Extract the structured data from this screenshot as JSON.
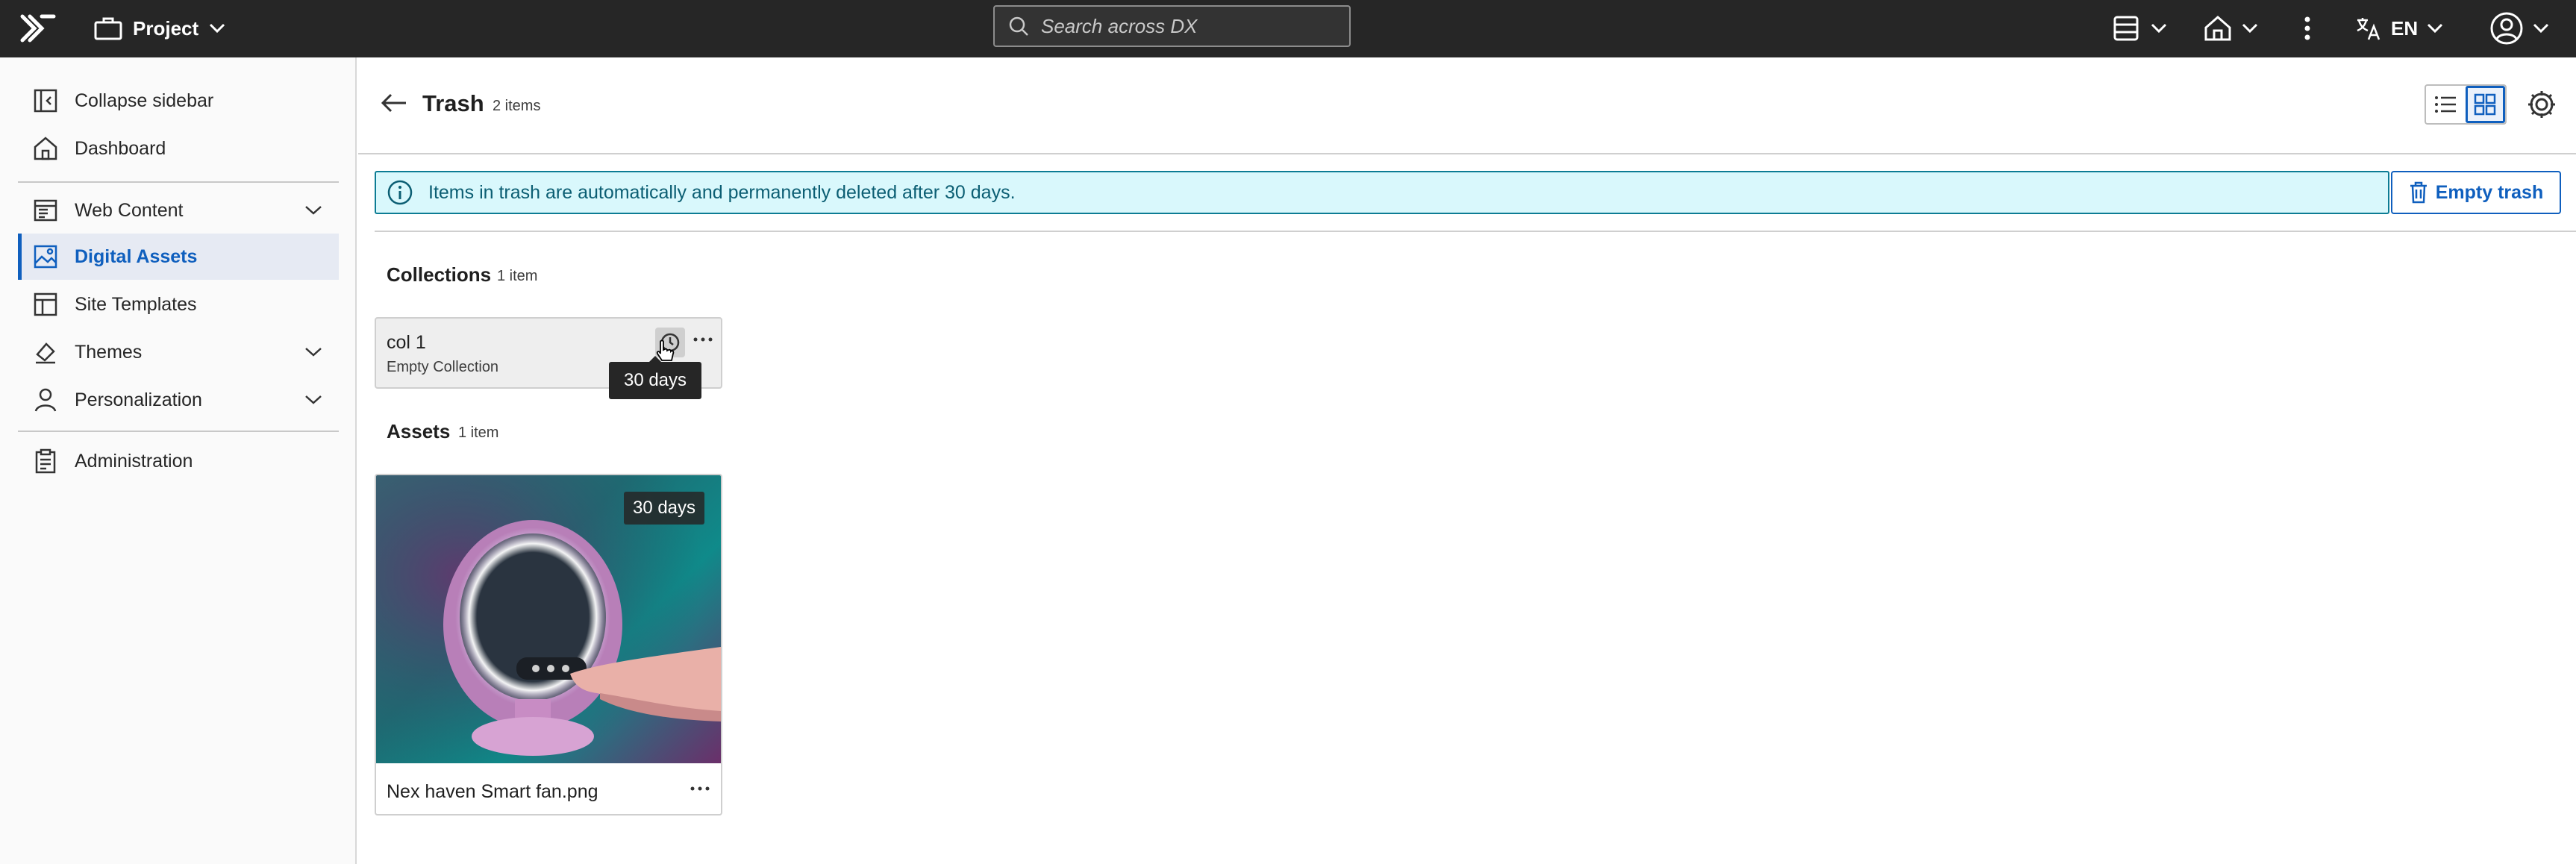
{
  "topbar": {
    "project_label": "Project",
    "search_placeholder": "Search across DX",
    "language": "EN",
    "icons": [
      "dx-logo-icon",
      "briefcase-icon",
      "chevron-down-icon",
      "search-icon",
      "content-manager-icon",
      "home-icon",
      "kebab-menu-icon",
      "translate-icon",
      "user-avatar-icon"
    ]
  },
  "sidebar": {
    "items": [
      {
        "label": "Collapse sidebar",
        "icon": "collapse-sidebar-icon"
      },
      {
        "label": "Dashboard",
        "icon": "home-icon"
      },
      {
        "label": "Web Content",
        "icon": "web-content-icon",
        "expandable": true
      },
      {
        "label": "Digital Assets",
        "icon": "image-icon",
        "active": true
      },
      {
        "label": "Site Templates",
        "icon": "template-icon"
      },
      {
        "label": "Themes",
        "icon": "paint-icon",
        "expandable": true
      },
      {
        "label": "Personalization",
        "icon": "person-icon",
        "expandable": true
      },
      {
        "label": "Administration",
        "icon": "clipboard-icon"
      }
    ]
  },
  "header": {
    "title": "Trash",
    "count": "2 items"
  },
  "banner": {
    "message": "Items in trash are automatically and permanently deleted after 30 days."
  },
  "actions": {
    "empty_trash": "Empty trash"
  },
  "collections": {
    "title": "Collections",
    "count": "1 item",
    "items": [
      {
        "name": "col 1",
        "subtitle": "Empty Collection",
        "tooltip": "30 days"
      }
    ]
  },
  "assets": {
    "title": "Assets",
    "count": "1 item",
    "items": [
      {
        "name": "Nex haven Smart fan.png",
        "badge": "30 days"
      }
    ]
  },
  "colors": {
    "accent": "#0f5fbe",
    "topbar": "#262626",
    "banner_bg": "#d9f8fc",
    "banner_border": "#0c7c94"
  }
}
